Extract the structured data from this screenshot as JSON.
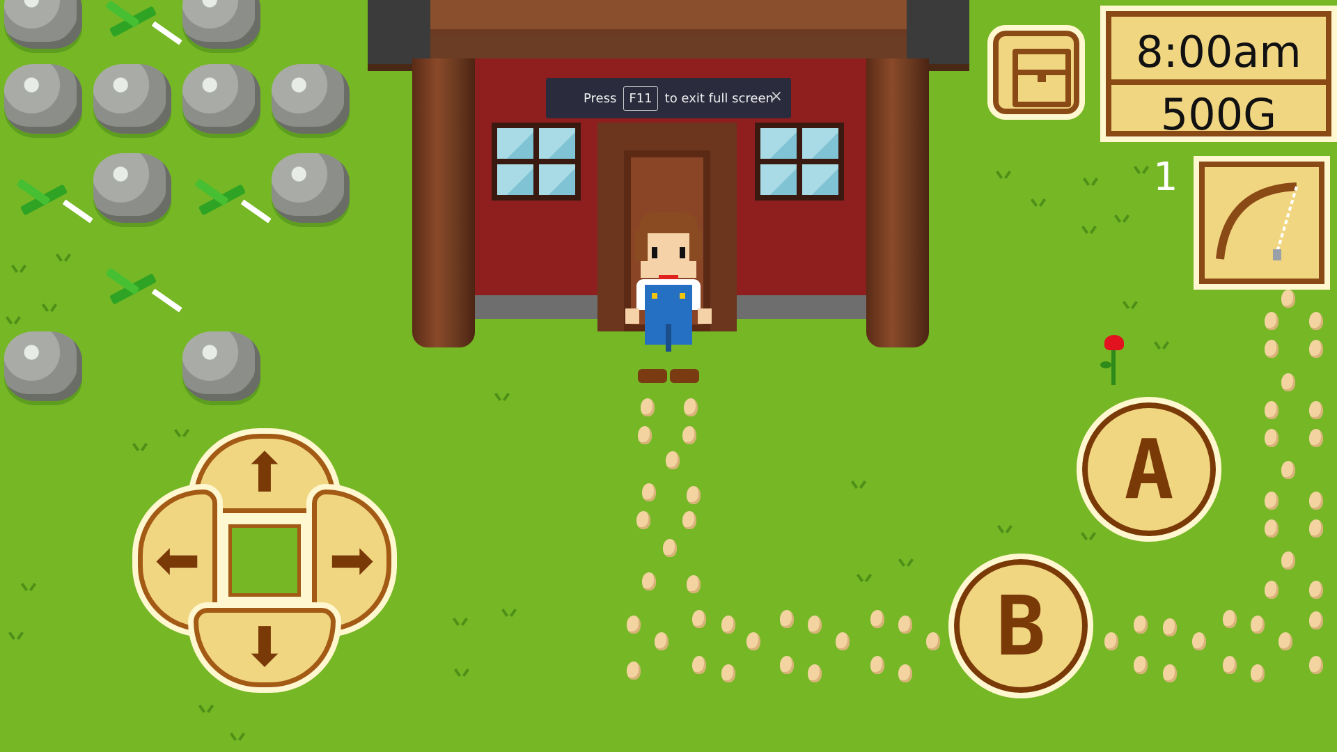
{
  "hud": {
    "time": "8:00am",
    "gold": "500G",
    "tool_count": "1",
    "chest_icon": "chest-icon",
    "tool_icon": "fishing-rod-icon"
  },
  "controls": {
    "up": "⬆",
    "down": "⬇",
    "left": "⬅",
    "right": "➡",
    "a_label": "A",
    "b_label": "B"
  },
  "toast": {
    "prefix": "Press",
    "key": "F11",
    "suffix": "to exit full screen",
    "close": "×"
  },
  "colors": {
    "grass": "#76b726",
    "ui_fill": "#f1d682",
    "ui_border": "#8a4a16",
    "house_wall": "#8f1f1f"
  }
}
